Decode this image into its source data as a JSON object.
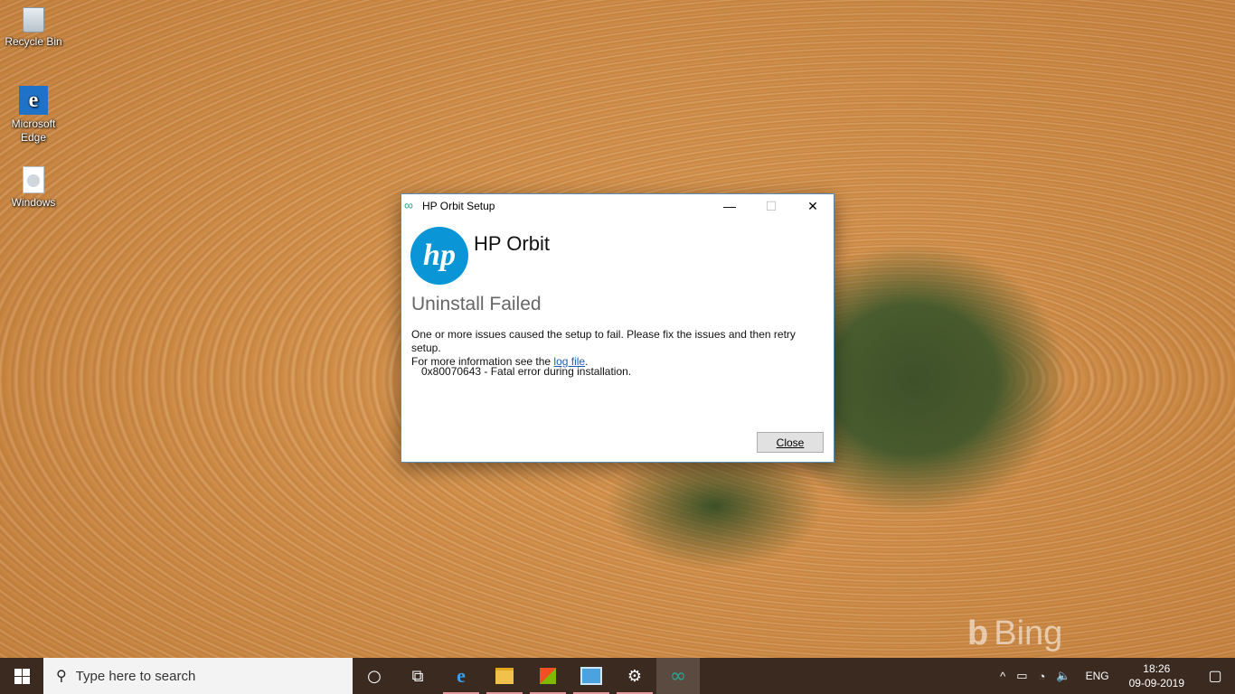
{
  "desktop": {
    "icons": [
      {
        "label": "Recycle Bin"
      },
      {
        "label": "Microsoft Edge"
      },
      {
        "label": "Windows"
      }
    ],
    "watermark": "Bing"
  },
  "dialog": {
    "title": "HP Orbit Setup",
    "controls": {
      "minimize": "—",
      "maximize": "☐",
      "close": "✕"
    },
    "logo_text": "hp",
    "product": "HP Orbit",
    "heading": "Uninstall Failed",
    "message_line1": "One or more issues caused the setup to fail. Please fix the issues and then retry setup.",
    "message_line2_prefix": "For more information see the ",
    "message_link": "log file",
    "message_line2_suffix": ".",
    "error": "0x80070643 - Fatal error during installation.",
    "close_button": "Close"
  },
  "taskbar": {
    "search_placeholder": "Type here to search",
    "tray": {
      "language": "ENG",
      "time": "18:26",
      "date": "09-09-2019"
    }
  }
}
